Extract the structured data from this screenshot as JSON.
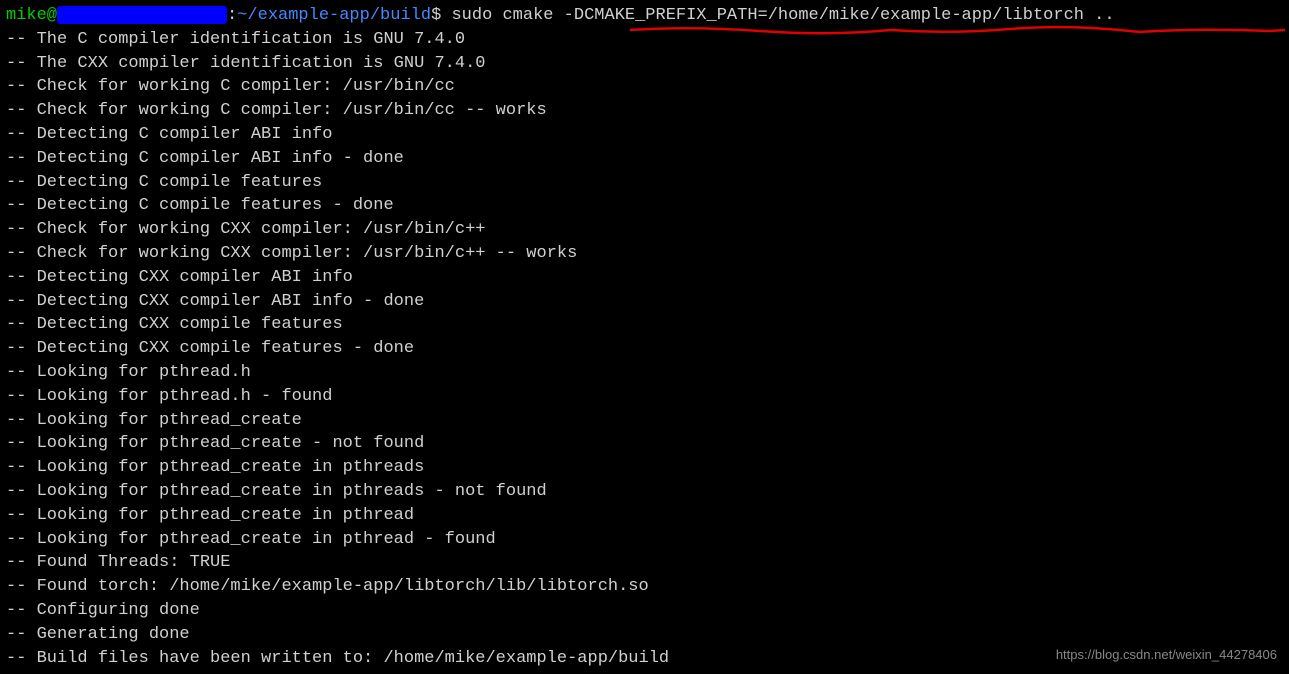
{
  "prompt": {
    "user": "mike@",
    "path": "~/example-app/build",
    "dollar": "$",
    "separator": ":"
  },
  "command": "sudo cmake -DCMAKE_PREFIX_PATH=/home/mike/example-app/libtorch ..",
  "output": [
    "-- The C compiler identification is GNU 7.4.0",
    "-- The CXX compiler identification is GNU 7.4.0",
    "-- Check for working C compiler: /usr/bin/cc",
    "-- Check for working C compiler: /usr/bin/cc -- works",
    "-- Detecting C compiler ABI info",
    "-- Detecting C compiler ABI info - done",
    "-- Detecting C compile features",
    "-- Detecting C compile features - done",
    "-- Check for working CXX compiler: /usr/bin/c++",
    "-- Check for working CXX compiler: /usr/bin/c++ -- works",
    "-- Detecting CXX compiler ABI info",
    "-- Detecting CXX compiler ABI info - done",
    "-- Detecting CXX compile features",
    "-- Detecting CXX compile features - done",
    "-- Looking for pthread.h",
    "-- Looking for pthread.h - found",
    "-- Looking for pthread_create",
    "-- Looking for pthread_create - not found",
    "-- Looking for pthread_create in pthreads",
    "-- Looking for pthread_create in pthreads - not found",
    "-- Looking for pthread_create in pthread",
    "-- Looking for pthread_create in pthread - found",
    "-- Found Threads: TRUE",
    "-- Found torch: /home/mike/example-app/libtorch/lib/libtorch.so",
    "-- Configuring done",
    "-- Generating done",
    "-- Build files have been written to: /home/mike/example-app/build"
  ],
  "watermark": "https://blog.csdn.net/weixin_44278406"
}
